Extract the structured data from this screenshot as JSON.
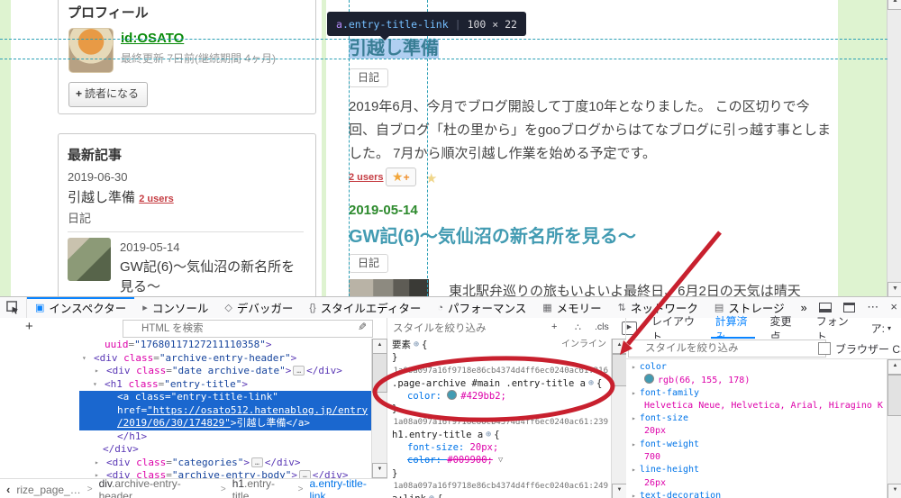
{
  "glyphs": {
    "up": "▲",
    "down": "▼",
    "left": "‹",
    "right": "›",
    "twisty_open": "▾",
    "twisty_closed": "▸",
    "target": "⊕",
    "funnel": "▽",
    "plus": "+",
    "more": "⋯",
    "close": "×",
    "eyedropper": "✎",
    "print": "▶"
  },
  "colors": {
    "accent_blue": "#0a84ff",
    "entry_link_teal": "#429bb2",
    "overridden_green": "#009900",
    "annotation_red": "#c8202e",
    "selection_blue": "#1a67cf",
    "date_green": "#2d8a2d",
    "badge_red": "#c53d43"
  },
  "page": {
    "tooltip": {
      "tag": "a",
      "cls": ".entry-title-link",
      "sep": "|",
      "dims": "100 × 22"
    },
    "sidebar": {
      "profile_title": "プロフィール",
      "user_id": "id:OSATO",
      "update_meta": "最終更新 7日前(継続期間 4ヶ月)",
      "follow_plus": "+",
      "follow_label": "読者になる",
      "recent_title": "最新記事",
      "entry1_date": "2019-06-30",
      "entry1_title": "引越し準備",
      "entry1_badge": "2 users",
      "entry1_category": "日記",
      "entry2_date": "2019-05-14",
      "entry2_title": "GW記(6)〜気仙沼の新名所を見る〜"
    },
    "main": {
      "entry1_title": "引越し準備",
      "entry1_category": "日記",
      "entry1_body": "2019年6月、今月でブログ開設して丁度10年となりました。 この区切りで今回、自ブログ「杜の里から」をgooブログからはてなブログに引っ越す事としました。 7月から順次引越し作業を始める予定です。",
      "entry1_users": "2 users",
      "star_plus_star": "★",
      "star_plus_sign": "+",
      "star_pale": "★",
      "entry2_date": "2019-05-14",
      "entry2_title": "GW記(6)〜気仙沼の新名所を見る〜",
      "entry2_category": "日記",
      "entry2_teaser": "東北駅弁巡りの旅もいよいよ最終日、6月2日の天気は晴天"
    }
  },
  "devtools": {
    "toolbar": {
      "tabs": [
        {
          "key": "inspector",
          "label": "インスペクター",
          "icon": "▣",
          "active": true
        },
        {
          "key": "console",
          "label": "コンソール",
          "icon": "▸"
        },
        {
          "key": "debugger",
          "label": "デバッガー",
          "icon": "◇"
        },
        {
          "key": "style-editor",
          "label": "スタイルエディター",
          "icon": "{}"
        },
        {
          "key": "performance",
          "label": "パフォーマンス",
          "icon": "◔"
        },
        {
          "key": "memory",
          "label": "メモリー",
          "icon": "▦"
        },
        {
          "key": "network",
          "label": "ネットワーク",
          "icon": "⇅"
        },
        {
          "key": "storage",
          "label": "ストレージ",
          "icon": "▤"
        },
        {
          "key": "more-tabs",
          "label": "»",
          "icon": ""
        }
      ],
      "window_controls": [
        {
          "key": "dock-side",
          "glyph": ""
        },
        {
          "key": "separate-window",
          "glyph": ""
        },
        {
          "key": "meatball-menu",
          "glyph": "⋯"
        },
        {
          "key": "close-devtools",
          "glyph": "×"
        }
      ]
    },
    "filters": {
      "html_search": "HTML を検索",
      "style_filter": "スタイルを絞り込み",
      "computed_filter": "スタイルを絞り込み",
      "browser_css": "ブラウザー CSS",
      "add": "+",
      "pseudo": "∴",
      "cls": ".cls"
    },
    "side_tabs": [
      {
        "key": "layout",
        "label": "レイアウト"
      },
      {
        "key": "computed",
        "label": "計算済み",
        "active": true
      },
      {
        "key": "changes",
        "label": "変更点"
      },
      {
        "key": "fonts",
        "label": "フォント"
      },
      {
        "key": "animations",
        "label": "ア:",
        "caret": true
      }
    ],
    "markup": {
      "lines": [
        {
          "pad": 116,
          "tokens": [
            {
              "c": "attr",
              "t": "uuid"
            },
            {
              "c": "pun",
              "t": "="
            },
            {
              "c": "val",
              "t": "\"17680117127211110358\""
            },
            {
              "c": "tag",
              "t": ">"
            }
          ]
        },
        {
          "pad": 104,
          "arrow": "down",
          "tokens": [
            {
              "c": "tag",
              "t": "<div "
            },
            {
              "c": "attr",
              "t": "class"
            },
            {
              "c": "pun",
              "t": "="
            },
            {
              "c": "val",
              "t": "\"archive-entry-header\""
            },
            {
              "c": "tag",
              "t": ">"
            }
          ]
        },
        {
          "pad": 118,
          "arrow": "right",
          "tokens": [
            {
              "c": "tag",
              "t": "<div "
            },
            {
              "c": "attr",
              "t": "class"
            },
            {
              "c": "pun",
              "t": "="
            },
            {
              "c": "val",
              "t": "\"date archive-date\""
            },
            {
              "c": "tag",
              "t": ">"
            },
            {
              "c": "badge",
              "t": "…"
            },
            {
              "c": "tag",
              "t": "</div>"
            }
          ]
        },
        {
          "pad": 116,
          "arrow": "down",
          "tokens": [
            {
              "c": "tag",
              "t": "<h1 "
            },
            {
              "c": "attr",
              "t": "class"
            },
            {
              "c": "pun",
              "t": "="
            },
            {
              "c": "val",
              "t": "\"entry-title\""
            },
            {
              "c": "tag",
              "t": ">"
            }
          ]
        },
        {
          "pad": 130,
          "sel": true,
          "tokens": [
            {
              "c": "tag",
              "t": "<a "
            },
            {
              "c": "attr",
              "t": "class"
            },
            {
              "c": "pun",
              "t": "="
            },
            {
              "c": "val",
              "t": "\"entry-title-link\""
            }
          ]
        },
        {
          "pad": 130,
          "sel": true,
          "tokens": [
            {
              "c": "attr",
              "t": "href"
            },
            {
              "c": "pun",
              "t": "="
            },
            {
              "c": "link",
              "t": "\"https://osato512.hatenablog.jp/entry"
            }
          ]
        },
        {
          "pad": 130,
          "sel": true,
          "tokens": [
            {
              "c": "link",
              "t": "/2019/06/30/174829\""
            },
            {
              "c": "tag",
              "t": ">"
            },
            {
              "c": "txt",
              "t": "引越し準備"
            },
            {
              "c": "tag",
              "t": "</a>"
            }
          ]
        },
        {
          "pad": 130,
          "tokens": [
            {
              "c": "tag",
              "t": "</h1>"
            }
          ]
        },
        {
          "pad": 114,
          "tokens": [
            {
              "c": "tag",
              "t": "</div>"
            }
          ]
        },
        {
          "pad": 118,
          "arrow": "right",
          "tokens": [
            {
              "c": "tag",
              "t": "<div "
            },
            {
              "c": "attr",
              "t": "class"
            },
            {
              "c": "pun",
              "t": "="
            },
            {
              "c": "val",
              "t": "\"categories\""
            },
            {
              "c": "tag",
              "t": ">"
            },
            {
              "c": "badge",
              "t": "…"
            },
            {
              "c": "tag",
              "t": "</div>"
            }
          ]
        },
        {
          "pad": 118,
          "arrow": "right",
          "tokens": [
            {
              "c": "tag",
              "t": "<div "
            },
            {
              "c": "attr",
              "t": "class"
            },
            {
              "c": "pun",
              "t": "="
            },
            {
              "c": "val",
              "t": "\"archive-entry-body\""
            },
            {
              "c": "tag",
              "t": ">"
            },
            {
              "c": "badge",
              "t": "…"
            },
            {
              "c": "tag",
              "t": "</div>"
            }
          ]
        }
      ]
    },
    "rules": {
      "inline_element_label": "要素",
      "inline_tag": "インライン",
      "lines": [
        {
          "k": "elem"
        },
        {
          "k": "close"
        },
        {
          "k": "src",
          "t": "1a08a097a16f9718e86cb4374d4ff6ec0240ac61:216"
        },
        {
          "k": "open",
          "sel": ".page-archive #main .entry-title a"
        },
        {
          "k": "decl",
          "p": "color",
          "v": "#429bb2",
          "swatch": "#429bb2"
        },
        {
          "k": "close"
        },
        {
          "k": "src",
          "t": "1a08a097a16f9718e86cb4374d4ff6ec0240ac61:239"
        },
        {
          "k": "open",
          "sel": "h1.entry-title a"
        },
        {
          "k": "decl",
          "p": "font-size",
          "v": "20px"
        },
        {
          "k": "decl",
          "p": "color",
          "v": "#009900",
          "struck": true,
          "funnel": true
        },
        {
          "k": "close"
        },
        {
          "k": "src",
          "t": "1a08a097a16f9718e86cb4374d4ff6ec0240ac61:249"
        },
        {
          "k": "open",
          "sel": "a:link"
        }
      ]
    },
    "computed": {
      "properties": [
        {
          "name": "color",
          "value": "rgb(66, 155, 178)",
          "swatch": "#429bb2"
        },
        {
          "name": "font-family",
          "value": "Helvetica Neue, Helvetica, Arial, Hiragino Kaku Go…"
        },
        {
          "name": "font-size",
          "value": "20px"
        },
        {
          "name": "font-weight",
          "value": "700"
        },
        {
          "name": "line-height",
          "value": "26px"
        },
        {
          "name": "text-decoration",
          "value": ""
        }
      ]
    },
    "breadcrumb": {
      "items": [
        {
          "tag": "",
          "rest": "rize_page_…"
        },
        {
          "tag": "div",
          "rest": ".archive-entry-header"
        },
        {
          "tag": "h1",
          "rest": ".entry-title"
        },
        {
          "tag": "a",
          "rest": ".entry-title-link",
          "active": true
        }
      ]
    }
  }
}
